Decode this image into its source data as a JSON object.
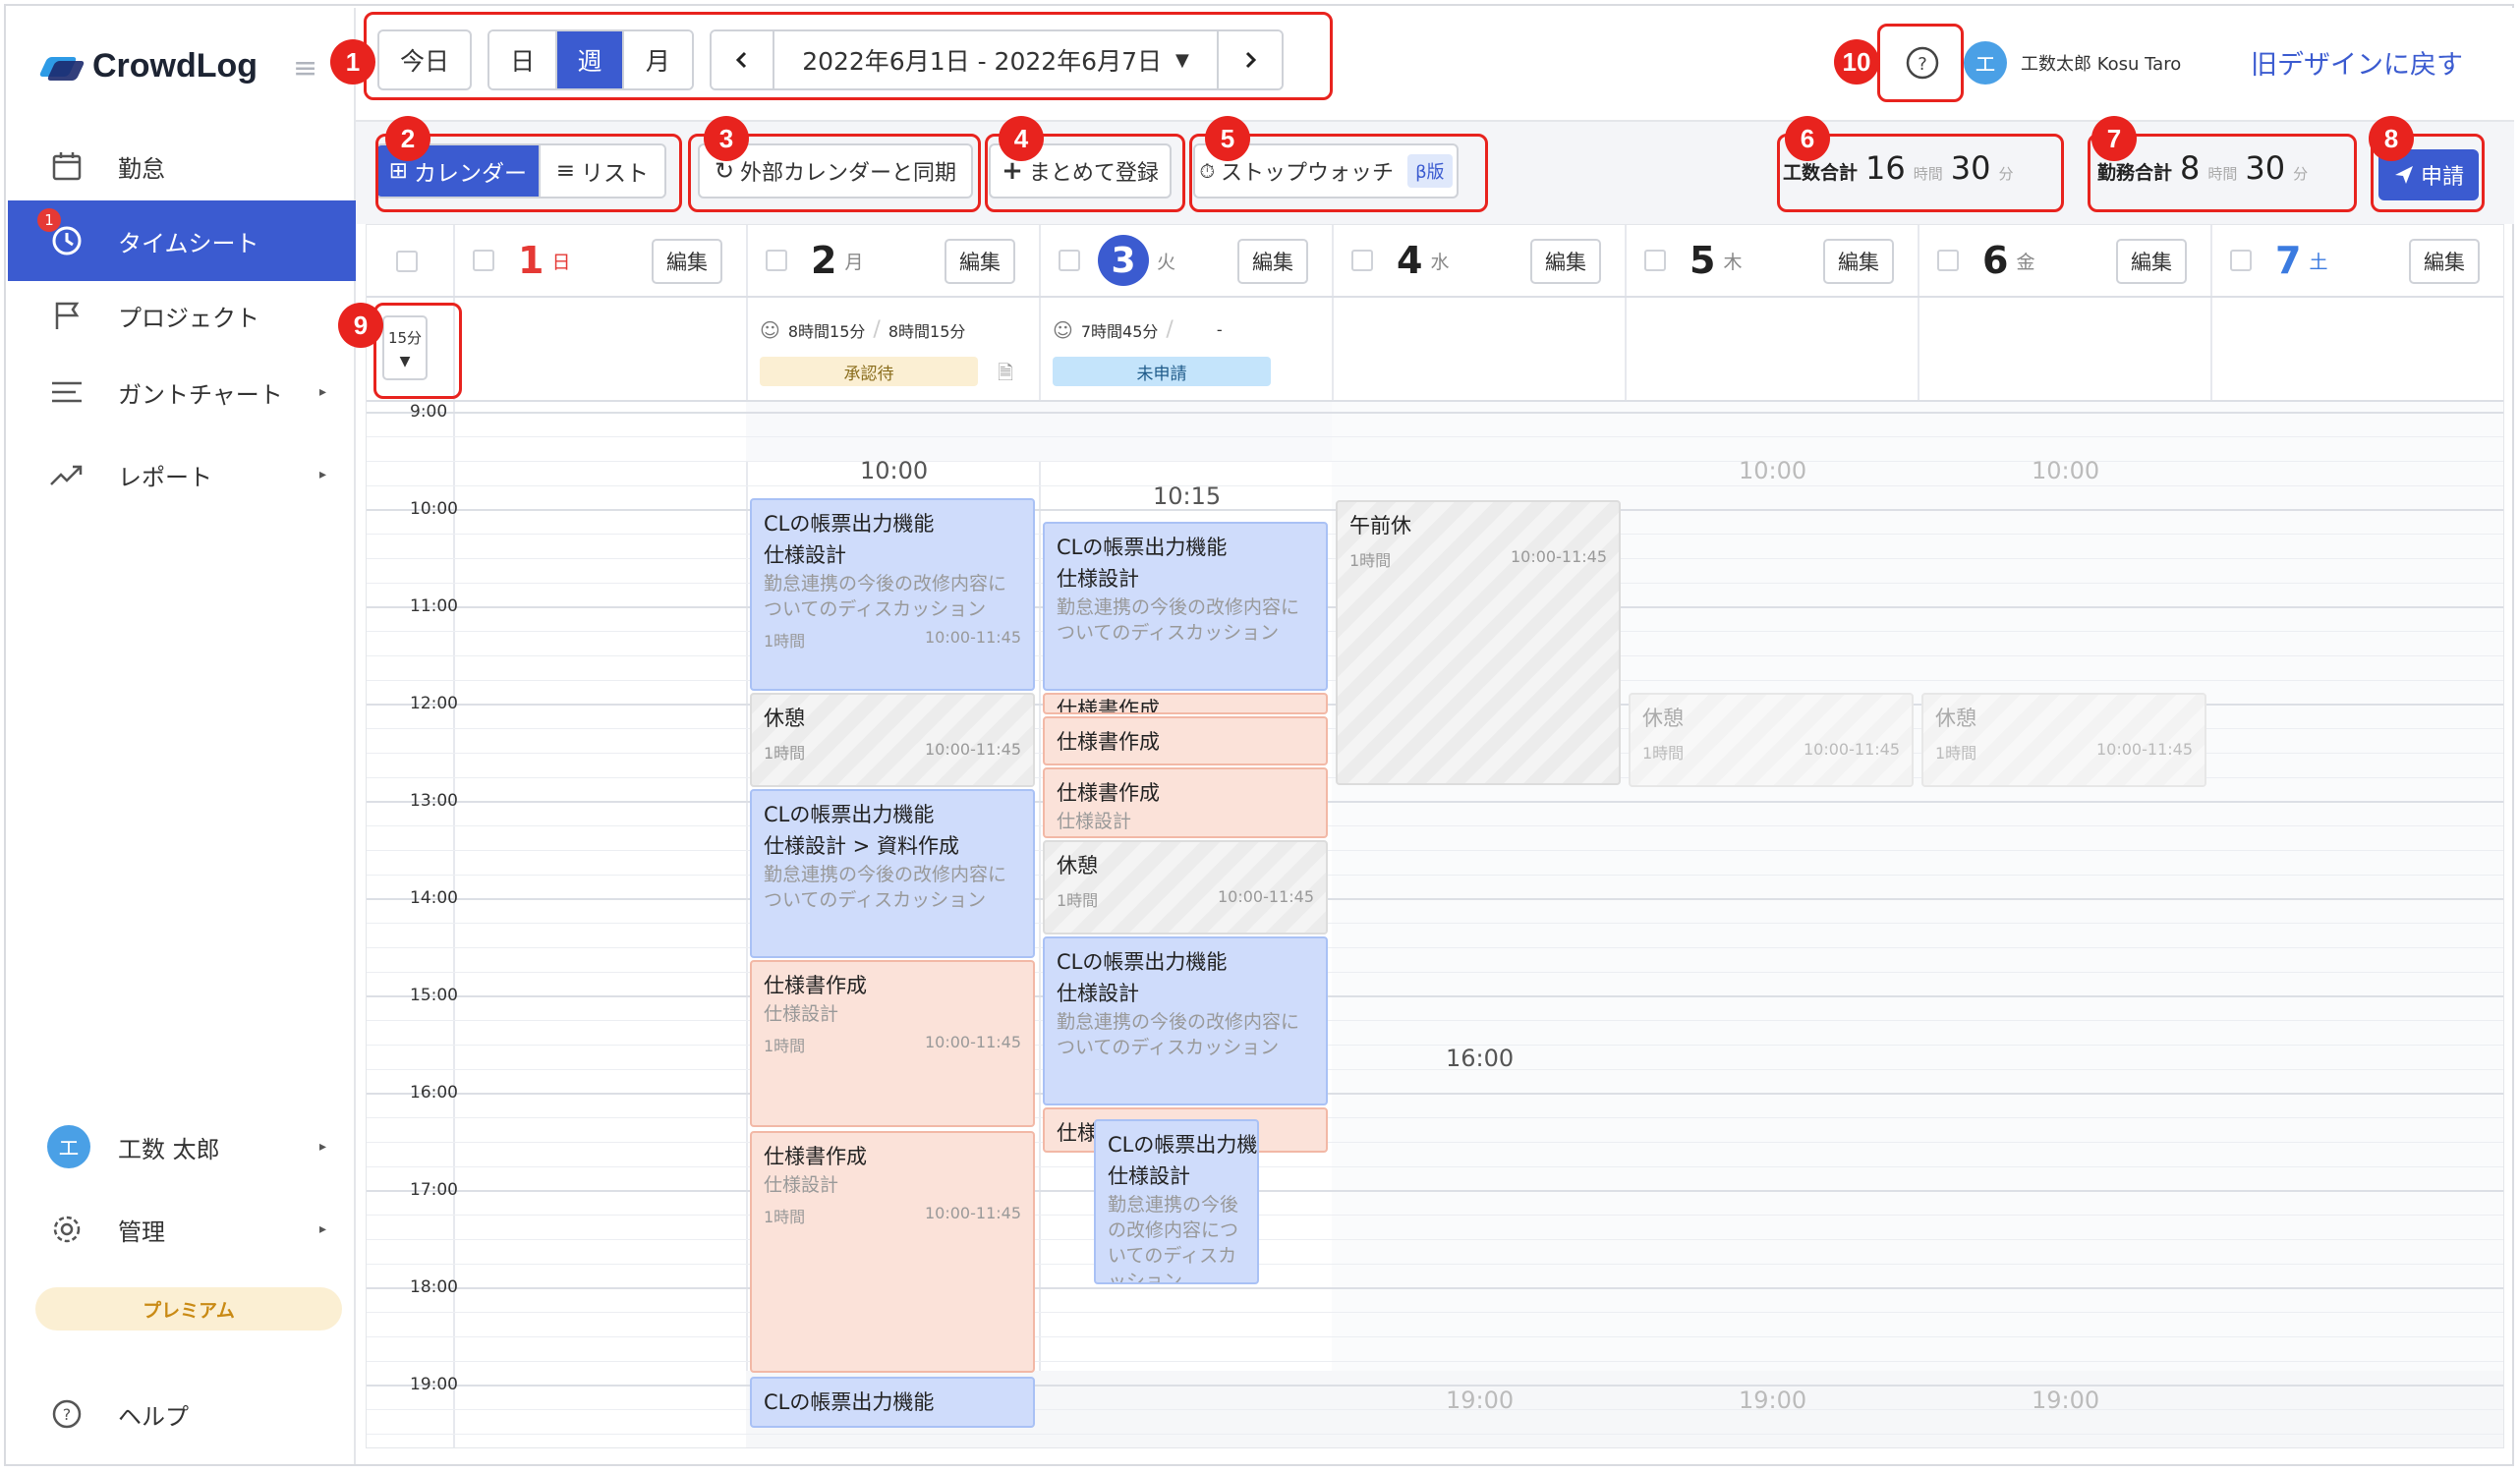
{
  "app": {
    "logo_text": "CrowdLog",
    "brand_color": "#3b5bd0"
  },
  "sidebar": {
    "items": [
      {
        "label": "勤怠",
        "icon": "calendar-icon"
      },
      {
        "label": "タイムシート",
        "icon": "clock-icon",
        "badge": "1",
        "active": true
      },
      {
        "label": "プロジェクト",
        "icon": "flag-icon"
      },
      {
        "label": "ガントチャート",
        "icon": "gantt-icon",
        "has_children": true
      },
      {
        "label": "レポート",
        "icon": "trend-icon",
        "has_children": true
      }
    ],
    "user": {
      "avatar": "エ",
      "name": "工数 太郎"
    },
    "admin": {
      "label": "管理"
    },
    "plan": "プレミアム",
    "help": {
      "label": "ヘルプ"
    }
  },
  "topbar": {
    "today": "今日",
    "views": [
      "日",
      "週",
      "月"
    ],
    "active_view": "週",
    "date_range": "2022年6月1日 - 2022年6月7日",
    "user_avatar": "エ",
    "user_name": "工数太郎 Kosu Taro",
    "legacy_link": "旧デザインに戻す"
  },
  "toolbar": {
    "calendar_btn": "カレンダー",
    "list_btn": "リスト",
    "sync_btn": "外部カレンダーと同期",
    "bulk_btn": "まとめて登録",
    "stopwatch_btn": "ストップウォッチ",
    "beta": "β版",
    "work_total_label": "工数合計",
    "work_total_hours": "16",
    "work_total_mins": "30",
    "attendance_label": "勤務合計",
    "attendance_hours": "8",
    "attendance_mins": "30",
    "unit_hour": "時間",
    "unit_min": "分",
    "apply_btn": "申請"
  },
  "calendar": {
    "interval": "15分",
    "edit_label": "編集",
    "days": [
      {
        "num": "1",
        "dow": "日",
        "color": "#e53935"
      },
      {
        "num": "2",
        "dow": "月",
        "color": "#222222"
      },
      {
        "num": "3",
        "dow": "火",
        "color": "#ffffff",
        "today": true
      },
      {
        "num": "4",
        "dow": "水",
        "color": "#222222"
      },
      {
        "num": "5",
        "dow": "木",
        "color": "#222222"
      },
      {
        "num": "6",
        "dow": "金",
        "color": "#222222"
      },
      {
        "num": "7",
        "dow": "土",
        "color": "#3b7be0"
      }
    ],
    "summaries": {
      "mon": {
        "actual": "8時間15分",
        "planned": "8時間15分",
        "status": "承認待"
      },
      "tue": {
        "actual": "7時間45分",
        "planned": "-",
        "status": "未申請"
      }
    },
    "hours": [
      "9:00",
      "10:00",
      "11:00",
      "12:00",
      "13:00",
      "14:00",
      "15:00",
      "16:00",
      "17:00",
      "18:00",
      "19:00"
    ],
    "markers": {
      "mon_start": "10:00",
      "tue_start": "10:15",
      "thu_start": "10:00",
      "fri_start": "10:00",
      "wed_end": "16:00",
      "end_wed": "19:00",
      "end_thu": "19:00",
      "end_fri": "19:00"
    },
    "events": {
      "mon1": {
        "title": "CLの帳票出力機能",
        "sub": "仕様設計",
        "desc": "勤怠連携の今後の改修内容についてのディスカッション",
        "dur": "1時間",
        "range": "10:00-11:45"
      },
      "mon2": {
        "title": "休憩",
        "dur": "1時間",
        "range": "10:00-11:45"
      },
      "mon3": {
        "title": "CLの帳票出力機能",
        "sub": "仕様設計 > 資料作成",
        "desc": "勤怠連携の今後の改修内容についてのディスカッション"
      },
      "mon4": {
        "title": "仕様書作成",
        "sub": "仕様設計",
        "dur": "1時間",
        "range": "10:00-11:45"
      },
      "mon5": {
        "title": "仕様書作成",
        "sub": "仕様設計",
        "dur": "1時間",
        "range": "10:00-11:45"
      },
      "mon6": {
        "title": "CLの帳票出力機能"
      },
      "tue1": {
        "title": "CLの帳票出力機能",
        "sub": "仕様設計",
        "desc": "勤怠連携の今後の改修内容についてのディスカッション"
      },
      "tue2": {
        "title": "仕様書作成"
      },
      "tue3": {
        "title": "仕様書作成"
      },
      "tue4": {
        "title": "仕様書作成",
        "sub": "仕様設計"
      },
      "tue5": {
        "title": "休憩",
        "dur": "1時間",
        "range": "10:00-11:45"
      },
      "tue6": {
        "title": "CLの帳票出力機能",
        "sub": "仕様設計",
        "desc": "勤怠連携の今後の改修内容についてのディスカッション"
      },
      "tue7": {
        "title": "仕様"
      },
      "tue8": {
        "title": "CLの帳票出力機",
        "sub": "仕様設計",
        "desc": "勤怠連携の今後の改修内容についてのディスカッション"
      },
      "wed1": {
        "title": "午前休",
        "dur": "1時間",
        "range": "10:00-11:45"
      },
      "thu1": {
        "title": "休憩",
        "dur": "1時間",
        "range": "10:00-11:45"
      },
      "fri1": {
        "title": "休憩",
        "dur": "1時間",
        "range": "10:00-11:45"
      }
    }
  },
  "callouts": [
    "1",
    "2",
    "3",
    "4",
    "5",
    "6",
    "7",
    "8",
    "9",
    "10"
  ]
}
